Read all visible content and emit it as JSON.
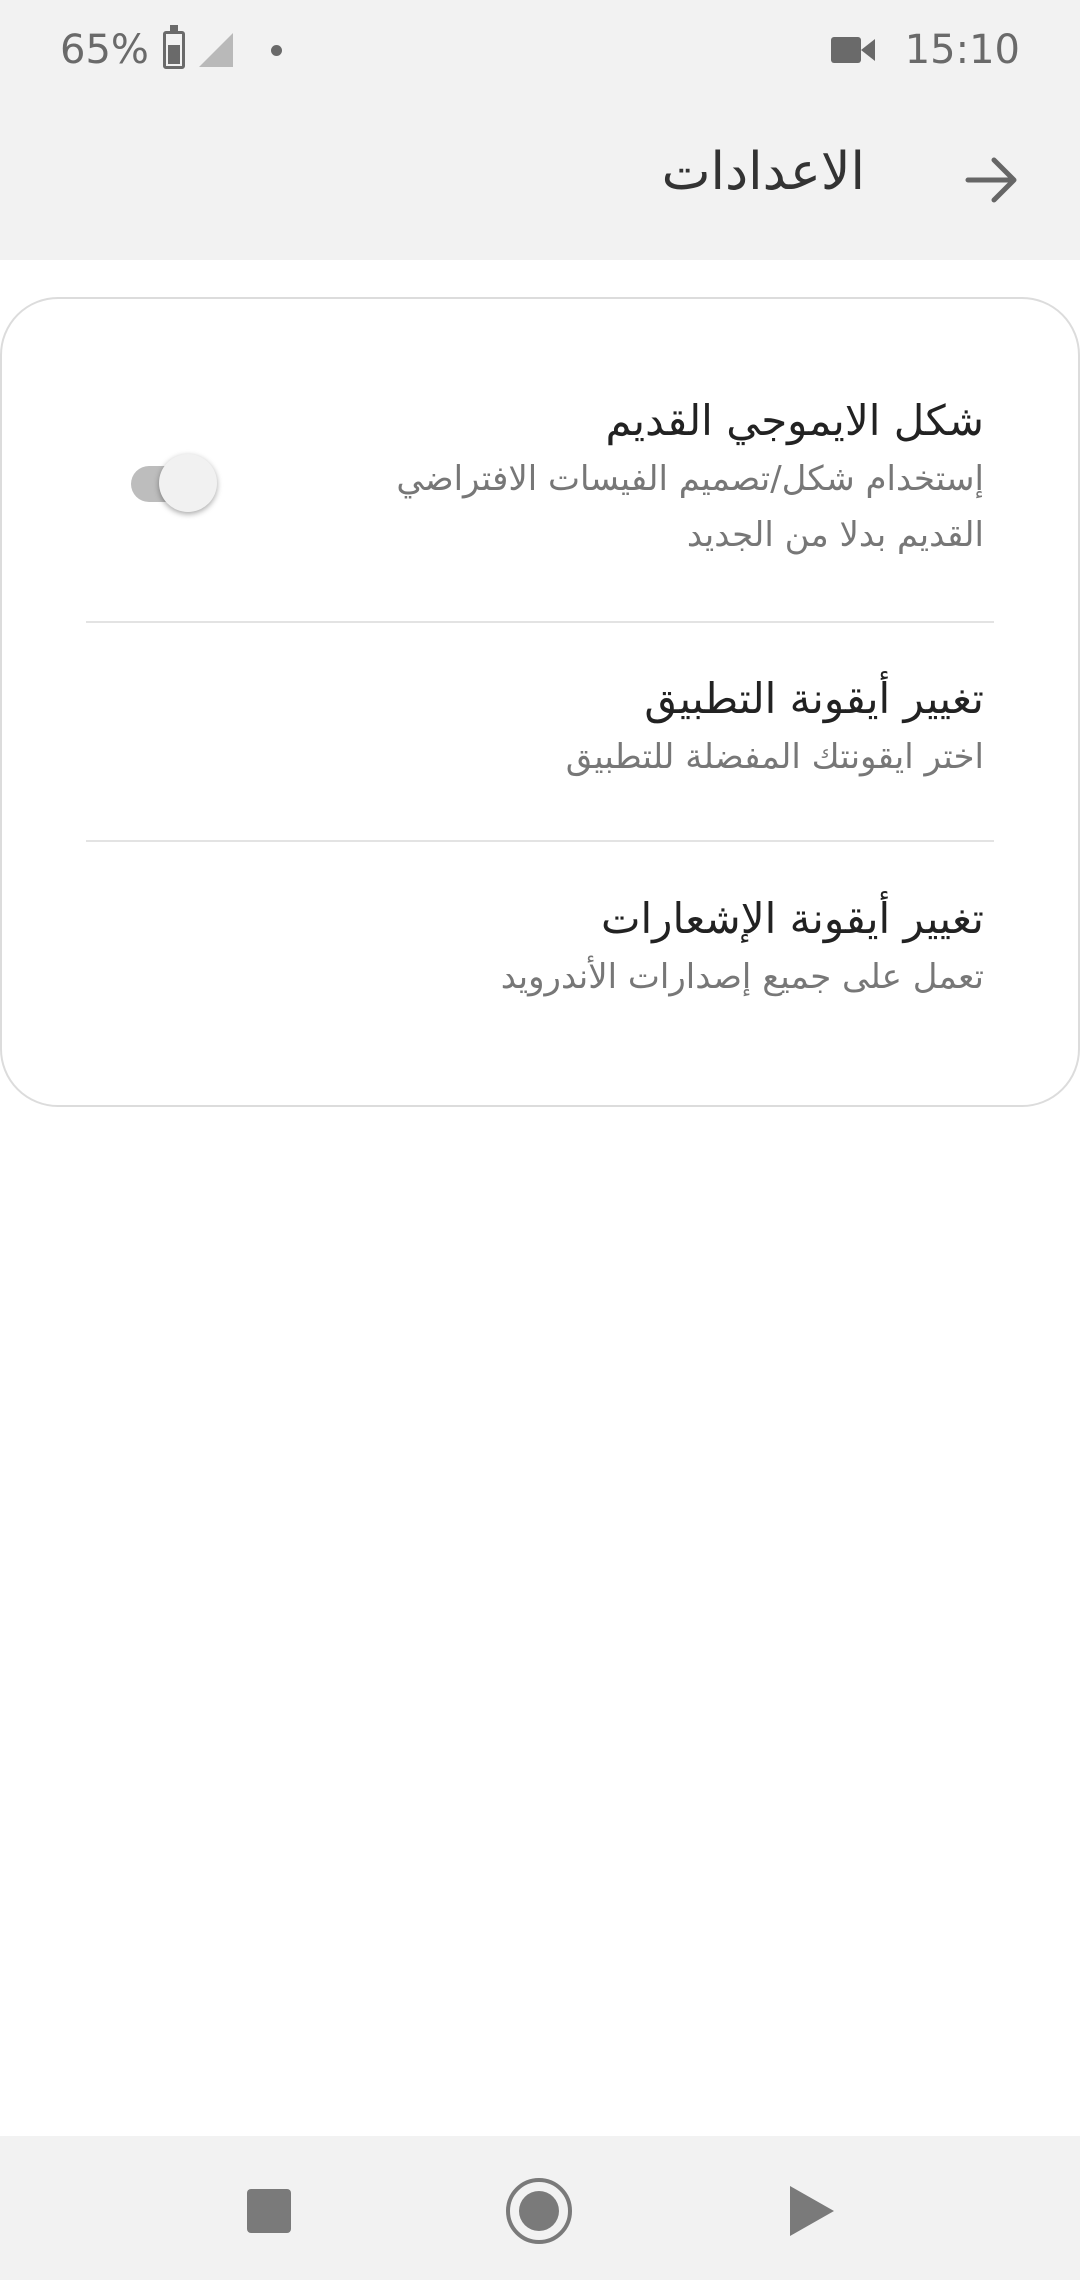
{
  "status_bar": {
    "battery_text": "65%",
    "time": "15:10"
  },
  "app_bar": {
    "title": "الاعدادات"
  },
  "settings": {
    "items": [
      {
        "title": "شكل الايموجي القديم",
        "subtitle_line1": "إستخدام شكل/تصميم الفيسات الافتراضي",
        "subtitle_line2": "القديم بدلا من الجديد",
        "toggle_on": false
      },
      {
        "title": "تغيير أيقونة التطبيق",
        "subtitle": "اختر ايقونتك المفضلة للتطبيق"
      },
      {
        "title": "تغيير أيقونة الإشعارات",
        "subtitle": "تعمل على جميع إصدارات الأندرويد"
      }
    ]
  },
  "icons": {
    "back": "arrow-right-icon",
    "recent": "square-icon",
    "home": "circle-icon",
    "nav_back": "triangle-icon",
    "video": "video-camera-icon",
    "battery": "battery-icon",
    "signal": "signal-icon"
  }
}
